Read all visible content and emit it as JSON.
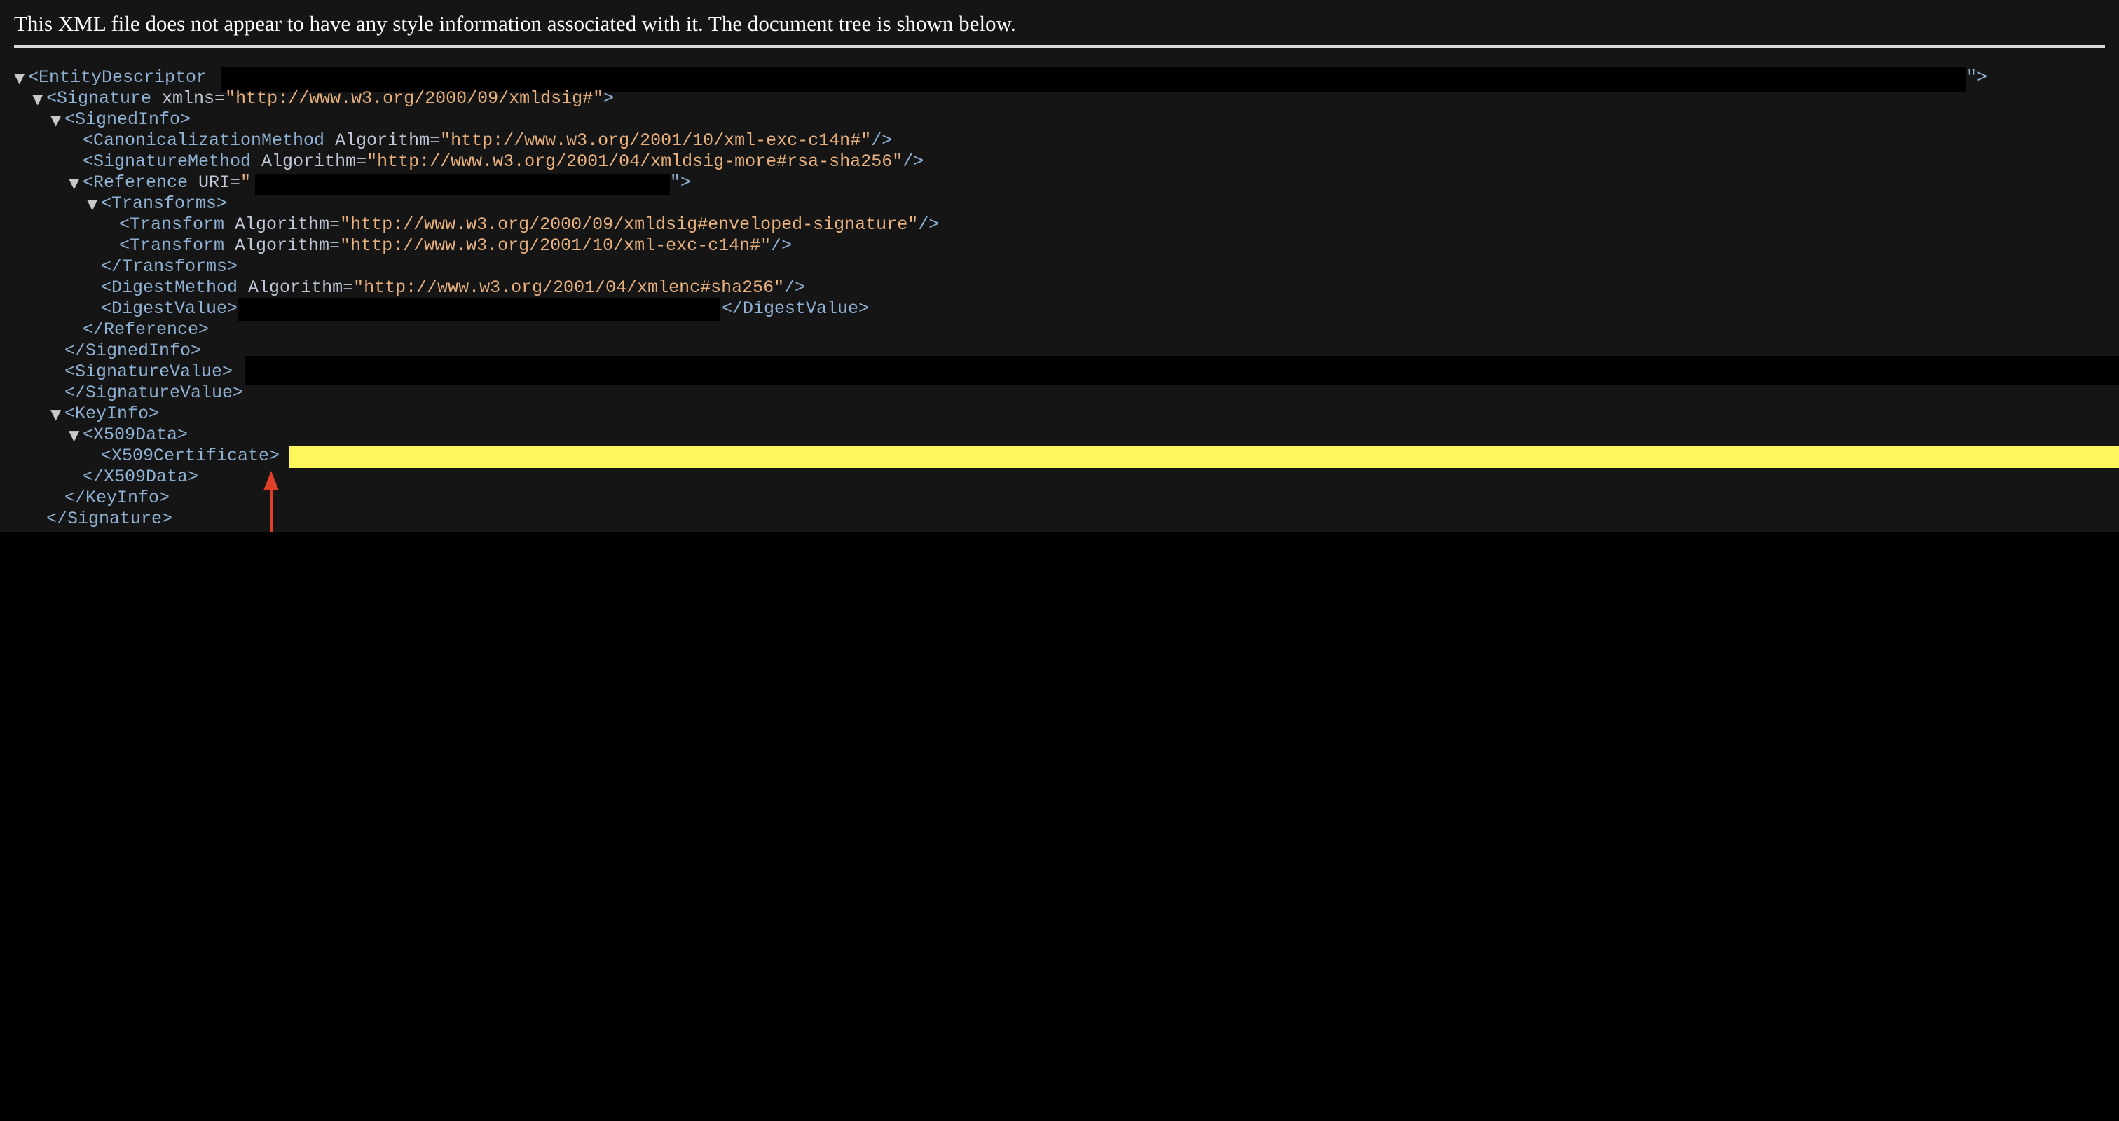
{
  "header": {
    "text": "This XML file does not appear to have any style information associated with it. The document tree is shown below."
  },
  "icons": {
    "expanded": "triangle-down-icon",
    "annotation": "red-arrow-icon"
  },
  "colors": {
    "background": "#151515",
    "tag": "#8fb1d4",
    "attribute_value": "#e8b17e",
    "highlight": "#fef65b",
    "arrow": "#e0402a"
  },
  "tree": {
    "l1": {
      "open": "<EntityDescriptor",
      "close": "\">"
    },
    "l2": {
      "open": "<Signature",
      "attr": " xmlns=",
      "val": "\"http://www.w3.org/2000/09/xmldsig#\"",
      "close": ">"
    },
    "l3": {
      "tag": "<SignedInfo>"
    },
    "l4": {
      "open": "<CanonicalizationMethod",
      "attr": " Algorithm=",
      "val": "\"http://www.w3.org/2001/10/xml-exc-c14n#\"",
      "close": "/>"
    },
    "l5": {
      "open": "<SignatureMethod",
      "attr": " Algorithm=",
      "val": "\"http://www.w3.org/2001/04/xmldsig-more#rsa-sha256\"",
      "close": "/>"
    },
    "l6": {
      "open": "<Reference",
      "attr": " URI=",
      "val": "\"",
      "close": "\">"
    },
    "l7": {
      "tag": "<Transforms>"
    },
    "l8": {
      "open": "<Transform",
      "attr": " Algorithm=",
      "val": "\"http://www.w3.org/2000/09/xmldsig#enveloped-signature\"",
      "close": "/>"
    },
    "l9": {
      "open": "<Transform",
      "attr": " Algorithm=",
      "val": "\"http://www.w3.org/2001/10/xml-exc-c14n#\"",
      "close": "/>"
    },
    "l10": {
      "tag": "</Transforms>"
    },
    "l11": {
      "open": "<DigestMethod",
      "attr": " Algorithm=",
      "val": "\"http://www.w3.org/2001/04/xmlenc#sha256\"",
      "close": "/>"
    },
    "l12": {
      "open": "<DigestValue>",
      "close": "</DigestValue>"
    },
    "l13": {
      "tag": "</Reference>"
    },
    "l14": {
      "tag": "</SignedInfo>"
    },
    "l15": {
      "open": "<SignatureValue>"
    },
    "l16": {
      "tag": "</SignatureValue>"
    },
    "l17": {
      "tag": "<KeyInfo>"
    },
    "l18": {
      "tag": "<X509Data>"
    },
    "l19": {
      "open": "<X509Certificate>"
    },
    "l20": {
      "tag": "</X509Data>"
    },
    "l21": {
      "tag": "</KeyInfo>"
    },
    "l22": {
      "tag": "</Signature>"
    }
  }
}
